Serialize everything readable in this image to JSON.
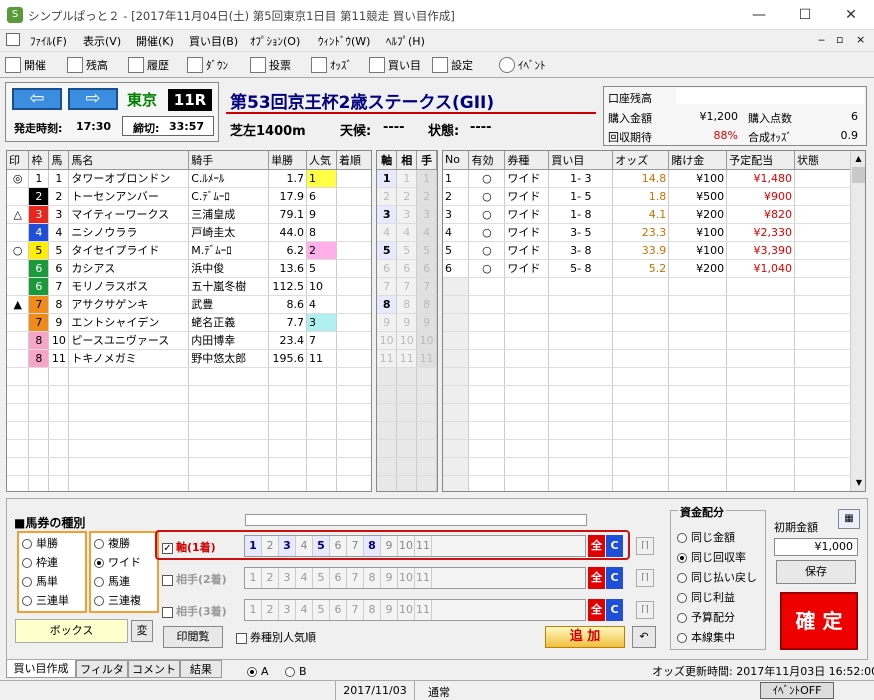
{
  "window": {
    "title": "シンプルぱっと２ - [2017年11月04日(土) 第5回東京1日目 第11競走 買い目作成]",
    "min": "—",
    "max": "☐",
    "close": "✕"
  },
  "menu": [
    "ﾌｧｲﾙ(F)",
    "表示(V)",
    "開催(K)",
    "買い目(B)",
    "ｵﾌﾟｼｮﾝ(O)",
    "ｳｨﾝﾄﾞｳ(W)",
    "ﾍﾙﾌﾟ(H)"
  ],
  "toolbar": [
    "開催",
    "残高",
    "履歴",
    "ﾀﾞｳﾝ",
    "投票",
    "ｵｯｽﾞ",
    "買い目",
    "設定",
    "ｲﾍﾞﾝﾄ"
  ],
  "race": {
    "venue": "東京",
    "number": "11R",
    "start_label": "発走時刻:",
    "start_time": "17:30",
    "close_label": "締切:",
    "close_time": "33:57",
    "name": "第53回京王杯2歳ステークス(GII)",
    "course": "芝左1400m",
    "weather_label": "天候:",
    "weather": "----",
    "condition_label": "状態:",
    "condition": "----"
  },
  "account": {
    "title": "口座残高",
    "purchase_label": "購入金額",
    "purchase": "¥1,200",
    "points_label": "購入点数",
    "points": "6",
    "expect_label": "回収期待",
    "expect": "88%",
    "synth_label": "合成ｵｯｽﾞ",
    "synth": "0.9"
  },
  "horse_headers": [
    "印",
    "枠",
    "馬",
    "馬名",
    "騎手",
    "単勝",
    "人気",
    "着順"
  ],
  "horses": [
    {
      "mark": "◎",
      "waku": "1",
      "num": "1",
      "name": "タワーオブロンドン",
      "jockey": "C.ﾙﾒｰﾙ",
      "odds": "1.7",
      "pop": "1"
    },
    {
      "mark": "",
      "waku": "2",
      "num": "2",
      "name": "トーセンアンバー",
      "jockey": "C.ﾃﾞﾑｰﾛ",
      "odds": "17.9",
      "pop": "6"
    },
    {
      "mark": "△",
      "waku": "3",
      "num": "3",
      "name": "マイティーワークス",
      "jockey": "三浦皇成",
      "odds": "79.1",
      "pop": "9"
    },
    {
      "mark": "",
      "waku": "4",
      "num": "4",
      "name": "ニシノウララ",
      "jockey": "戸崎圭太",
      "odds": "44.0",
      "pop": "8"
    },
    {
      "mark": "○",
      "waku": "5",
      "num": "5",
      "name": "タイセイプライド",
      "jockey": "M.ﾃﾞﾑｰﾛ",
      "odds": "6.2",
      "pop": "2"
    },
    {
      "mark": "",
      "waku": "6",
      "num": "6",
      "name": "カシアス",
      "jockey": "浜中俊",
      "odds": "13.6",
      "pop": "5"
    },
    {
      "mark": "",
      "waku": "6",
      "num": "7",
      "name": "モリノラスボス",
      "jockey": "五十嵐冬樹",
      "odds": "112.5",
      "pop": "10"
    },
    {
      "mark": "▲",
      "waku": "7",
      "num": "8",
      "name": "アサクサゲンキ",
      "jockey": "武豊",
      "odds": "8.6",
      "pop": "4"
    },
    {
      "mark": "",
      "waku": "7",
      "num": "9",
      "name": "エントシャイデン",
      "jockey": "蛯名正義",
      "odds": "7.7",
      "pop": "3"
    },
    {
      "mark": "",
      "waku": "8",
      "num": "10",
      "name": "ピースユニヴァース",
      "jockey": "内田博幸",
      "odds": "23.4",
      "pop": "7"
    },
    {
      "mark": "",
      "waku": "8",
      "num": "11",
      "name": "トキノメガミ",
      "jockey": "野中悠太郎",
      "odds": "195.6",
      "pop": "11"
    }
  ],
  "axis_headers": [
    "軸",
    "相",
    "手"
  ],
  "axis_selected": [
    "1",
    "3",
    "5",
    "8"
  ],
  "bet_headers": [
    "No",
    "有効",
    "券種",
    "買い目",
    "オッズ",
    "賭け金",
    "予定配当",
    "状態"
  ],
  "bets": [
    {
      "no": "1",
      "valid": "○",
      "type": "ワイド",
      "combo": "1- 3",
      "odds": "14.8",
      "stake": "¥100",
      "payout": "¥1,480"
    },
    {
      "no": "2",
      "valid": "○",
      "type": "ワイド",
      "combo": "1- 5",
      "odds": "1.8",
      "stake": "¥500",
      "payout": "¥900"
    },
    {
      "no": "3",
      "valid": "○",
      "type": "ワイド",
      "combo": "1- 8",
      "odds": "4.1",
      "stake": "¥200",
      "payout": "¥820"
    },
    {
      "no": "4",
      "valid": "○",
      "type": "ワイド",
      "combo": "3- 5",
      "odds": "23.3",
      "stake": "¥100",
      "payout": "¥2,330"
    },
    {
      "no": "5",
      "valid": "○",
      "type": "ワイド",
      "combo": "3- 8",
      "odds": "33.9",
      "stake": "¥100",
      "payout": "¥3,390"
    },
    {
      "no": "6",
      "valid": "○",
      "type": "ワイド",
      "combo": "5- 8",
      "odds": "5.2",
      "stake": "¥200",
      "payout": "¥1,040"
    }
  ],
  "ticket": {
    "title": "■馬券の種別",
    "types_left": [
      "単勝",
      "枠連",
      "馬単",
      "三連単"
    ],
    "types_right": [
      "複勝",
      "ワイド",
      "馬連",
      "三連複"
    ],
    "selected": "ワイド",
    "mode": "ボックス",
    "mode_btn": "変",
    "print_btn": "印閲覧",
    "sort_label": "券種別人気順",
    "rows": [
      "軸(1着)",
      "相手(2着)",
      "相手(3着)"
    ],
    "numbers": [
      "1",
      "2",
      "3",
      "4",
      "5",
      "6",
      "7",
      "8",
      "9",
      "10",
      "11"
    ],
    "all_btn": "全",
    "clear_btn": "C",
    "add_btn": "追 加"
  },
  "fund": {
    "title": "資金配分",
    "options": [
      "同じ金額",
      "同じ回収率",
      "同じ払い戻し",
      "同じ利益",
      "予算配分",
      "本線集中"
    ],
    "selected": "同じ回収率",
    "initial_label": "初期金額",
    "initial": "¥1,000",
    "save_btn": "保存",
    "confirm_btn": "確 定"
  },
  "tabs": [
    "買い目作成",
    "フィルタ",
    "コメント",
    "結果"
  ],
  "radio_ab": [
    "A",
    "B"
  ],
  "odds_update": "オッズ更新時間: 2017年11月03日 16:52:00",
  "status": {
    "date": "2017/11/03",
    "mode": "通常",
    "event": "ｲﾍﾞﾝﾄOFF"
  },
  "colors": {
    "waku1": "#ffffff",
    "waku2": "#000000",
    "waku3": "#e8261e",
    "waku4": "#1f4fd8",
    "waku5": "#ffee00",
    "waku6": "#1a9a3a",
    "waku7": "#f08a18",
    "waku8": "#f7a6c8",
    "red": "#e00000",
    "orange": "#d07000"
  }
}
